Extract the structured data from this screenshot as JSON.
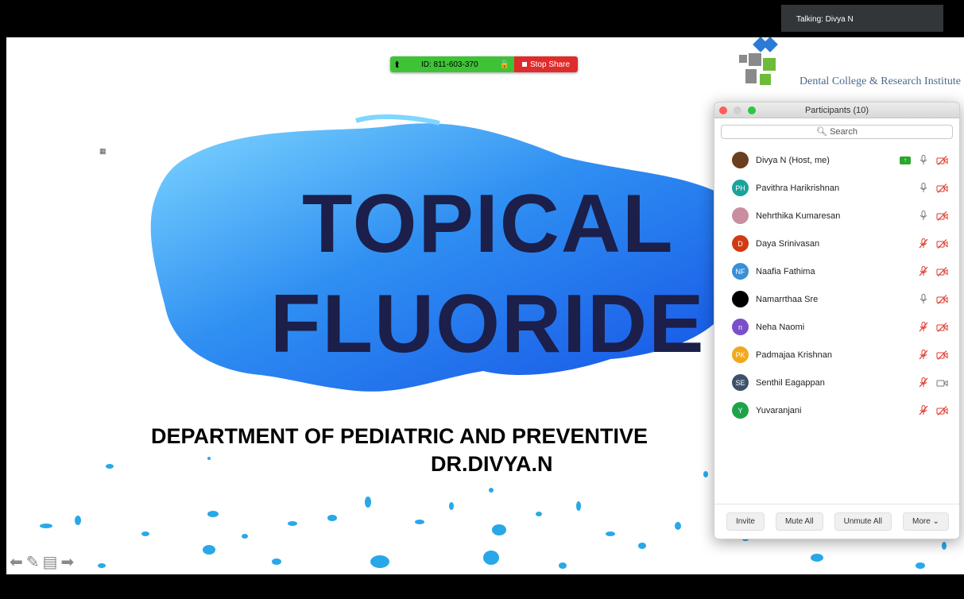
{
  "share_bar": {
    "meeting_id": "ID: 811-603-370",
    "stop_share": "Stop Share"
  },
  "talking": "Talking: Divya N",
  "logo": {
    "institute": "Dental College & Research Institute"
  },
  "slide": {
    "title_line1": "TOPICAL",
    "title_line2": "FLUORIDE",
    "department": "DEPARTMENT OF PEDIATRIC AND PREVENTIVE",
    "presenter": "DR.DIVYA.N",
    "colors": {
      "title": "#1b1f4a",
      "blob": "#2e8cf0"
    }
  },
  "participants_panel": {
    "title": "Participants (10)",
    "search_placeholder": "Search",
    "participants": [
      {
        "name": "Divya N (Host, me)",
        "initials": "",
        "avatar_color": "#6b3e1e",
        "sharing": true,
        "mic": "on",
        "video": "off"
      },
      {
        "name": "Pavithra Harikrishnan",
        "initials": "PH",
        "avatar_color": "#1aa39a",
        "sharing": false,
        "mic": "on",
        "video": "off"
      },
      {
        "name": "Nehrthika Kumaresan",
        "initials": "",
        "avatar_color": "#c98ea0",
        "sharing": false,
        "mic": "on",
        "video": "off"
      },
      {
        "name": "Daya Srinivasan",
        "initials": "D",
        "avatar_color": "#d13a12",
        "sharing": false,
        "mic": "muted",
        "video": "off"
      },
      {
        "name": "Naafia Fathima",
        "initials": "NF",
        "avatar_color": "#3a8fd6",
        "sharing": false,
        "mic": "muted",
        "video": "off"
      },
      {
        "name": "Namarrthaa Sre",
        "initials": "",
        "avatar_color": "#000000",
        "sharing": false,
        "mic": "on",
        "video": "off"
      },
      {
        "name": "Neha Naomi",
        "initials": "n",
        "avatar_color": "#7a4fc9",
        "sharing": false,
        "mic": "muted",
        "video": "off"
      },
      {
        "name": "Padmajaa Krishnan",
        "initials": "PK",
        "avatar_color": "#f2a81d",
        "sharing": false,
        "mic": "muted",
        "video": "off"
      },
      {
        "name": "Senthil Eagappan",
        "initials": "SE",
        "avatar_color": "#3d5169",
        "sharing": false,
        "mic": "muted",
        "video": "on"
      },
      {
        "name": "Yuvaranjani",
        "initials": "Y",
        "avatar_color": "#1fa34a",
        "sharing": false,
        "mic": "muted",
        "video": "off"
      }
    ],
    "buttons": {
      "invite": "Invite",
      "mute_all": "Mute All",
      "unmute_all": "Unmute All",
      "more": "More ⌄"
    }
  },
  "annotation_tools": [
    "arrow-left-icon",
    "pencil-icon",
    "notes-icon",
    "arrow-right-icon"
  ]
}
